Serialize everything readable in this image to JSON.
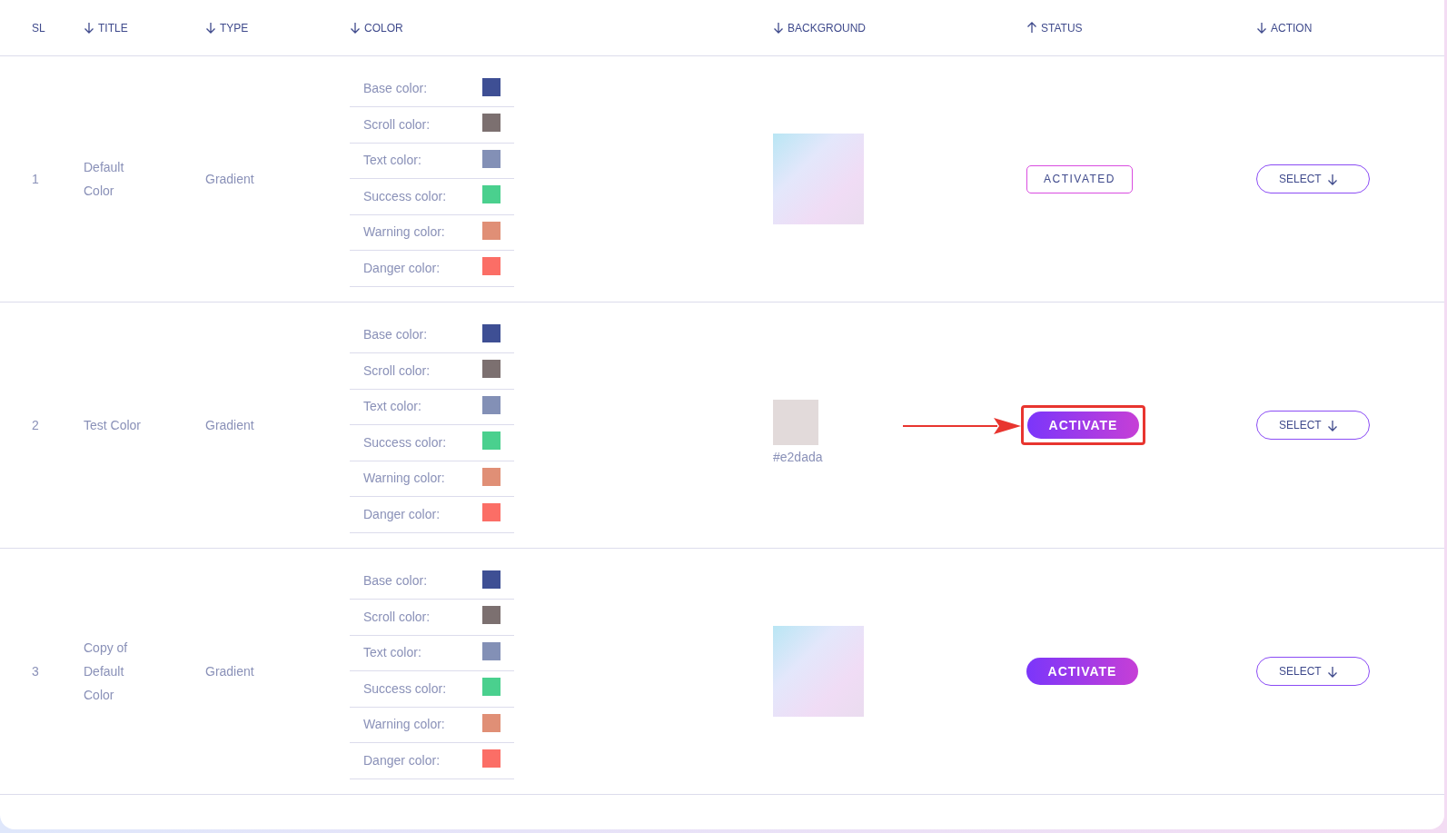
{
  "columns": [
    {
      "label": "SL"
    },
    {
      "label": "TITLE",
      "ascending": false
    },
    {
      "label": "TYPE",
      "ascending": false
    },
    {
      "label": "COLOR",
      "ascending": false
    },
    {
      "label": "BACKGROUND",
      "ascending": false
    },
    {
      "label": "STATUS",
      "ascending": true
    },
    {
      "label": "ACTION",
      "ascending": false
    }
  ],
  "rows": [
    {
      "sl": "1",
      "title": "Default Color",
      "type": "Gradient",
      "colors": [
        {
          "label": "Base color:",
          "color": "#3e4f94"
        },
        {
          "label": "Scroll color:",
          "color": "#7c7070"
        },
        {
          "label": "Text color:",
          "color": "#8390b6"
        },
        {
          "label": "Success color:",
          "color": "#4ad08e"
        },
        {
          "label": "Warning color:",
          "color": "#e08f76"
        },
        {
          "label": "Danger color:",
          "color": "#fb6e66"
        }
      ],
      "background": {
        "kind": "image"
      },
      "status": {
        "kind": "activated",
        "label": "ACTIVATED",
        "highlighted": false
      },
      "action": "SELECT"
    },
    {
      "sl": "2",
      "title": "Test Color",
      "type": "Gradient",
      "colors": [
        {
          "label": "Base color:",
          "color": "#3e4f94"
        },
        {
          "label": "Scroll color:",
          "color": "#7c7070"
        },
        {
          "label": "Text color:",
          "color": "#8390b6"
        },
        {
          "label": "Success color:",
          "color": "#4ad08e"
        },
        {
          "label": "Warning color:",
          "color": "#e08f76"
        },
        {
          "label": "Danger color:",
          "color": "#fb6e66"
        }
      ],
      "background": {
        "kind": "solid",
        "color": "#e2dada",
        "caption": "#e2dada"
      },
      "status": {
        "kind": "activate",
        "label": "ACTIVATE",
        "highlighted": true
      },
      "action": "SELECT"
    },
    {
      "sl": "3",
      "title": "Copy of Default Color",
      "type": "Gradient",
      "colors": [
        {
          "label": "Base color:",
          "color": "#3e4f94"
        },
        {
          "label": "Scroll color:",
          "color": "#7c7070"
        },
        {
          "label": "Text color:",
          "color": "#8390b6"
        },
        {
          "label": "Success color:",
          "color": "#4ad08e"
        },
        {
          "label": "Warning color:",
          "color": "#e08f76"
        },
        {
          "label": "Danger color:",
          "color": "#fb6e66"
        }
      ],
      "background": {
        "kind": "image"
      },
      "status": {
        "kind": "activate",
        "label": "ACTIVATE",
        "highlighted": false
      },
      "action": "SELECT"
    }
  ]
}
